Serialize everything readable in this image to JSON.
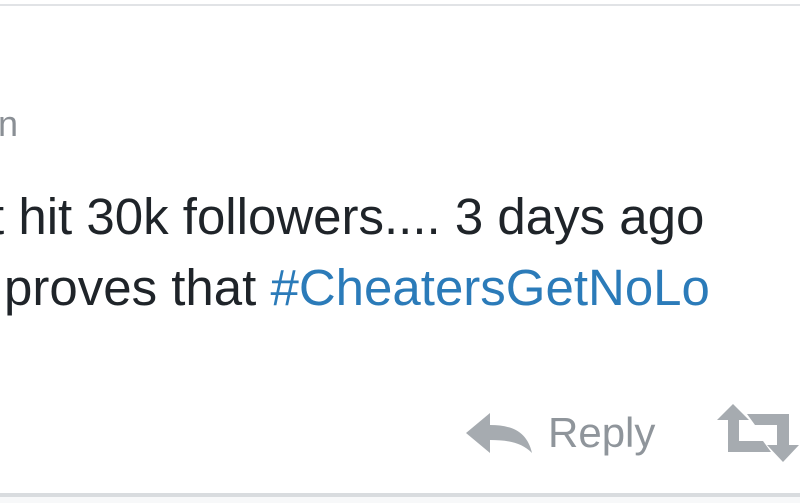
{
  "tweet": {
    "meta_fragment": "n",
    "line_1": "t hit 30k followers.... 3 days ago",
    "line_2_prefix": "proves that ",
    "hashtag": "#CheatersGetNoLo"
  },
  "actions": {
    "reply_label": "Reply",
    "reply_icon": "reply-icon",
    "retweet_icon": "retweet-icon"
  },
  "colors": {
    "text": "#1f2429",
    "muted": "#8f959b",
    "hashtag": "#2b7bb9",
    "border": "#e1e3e6"
  }
}
